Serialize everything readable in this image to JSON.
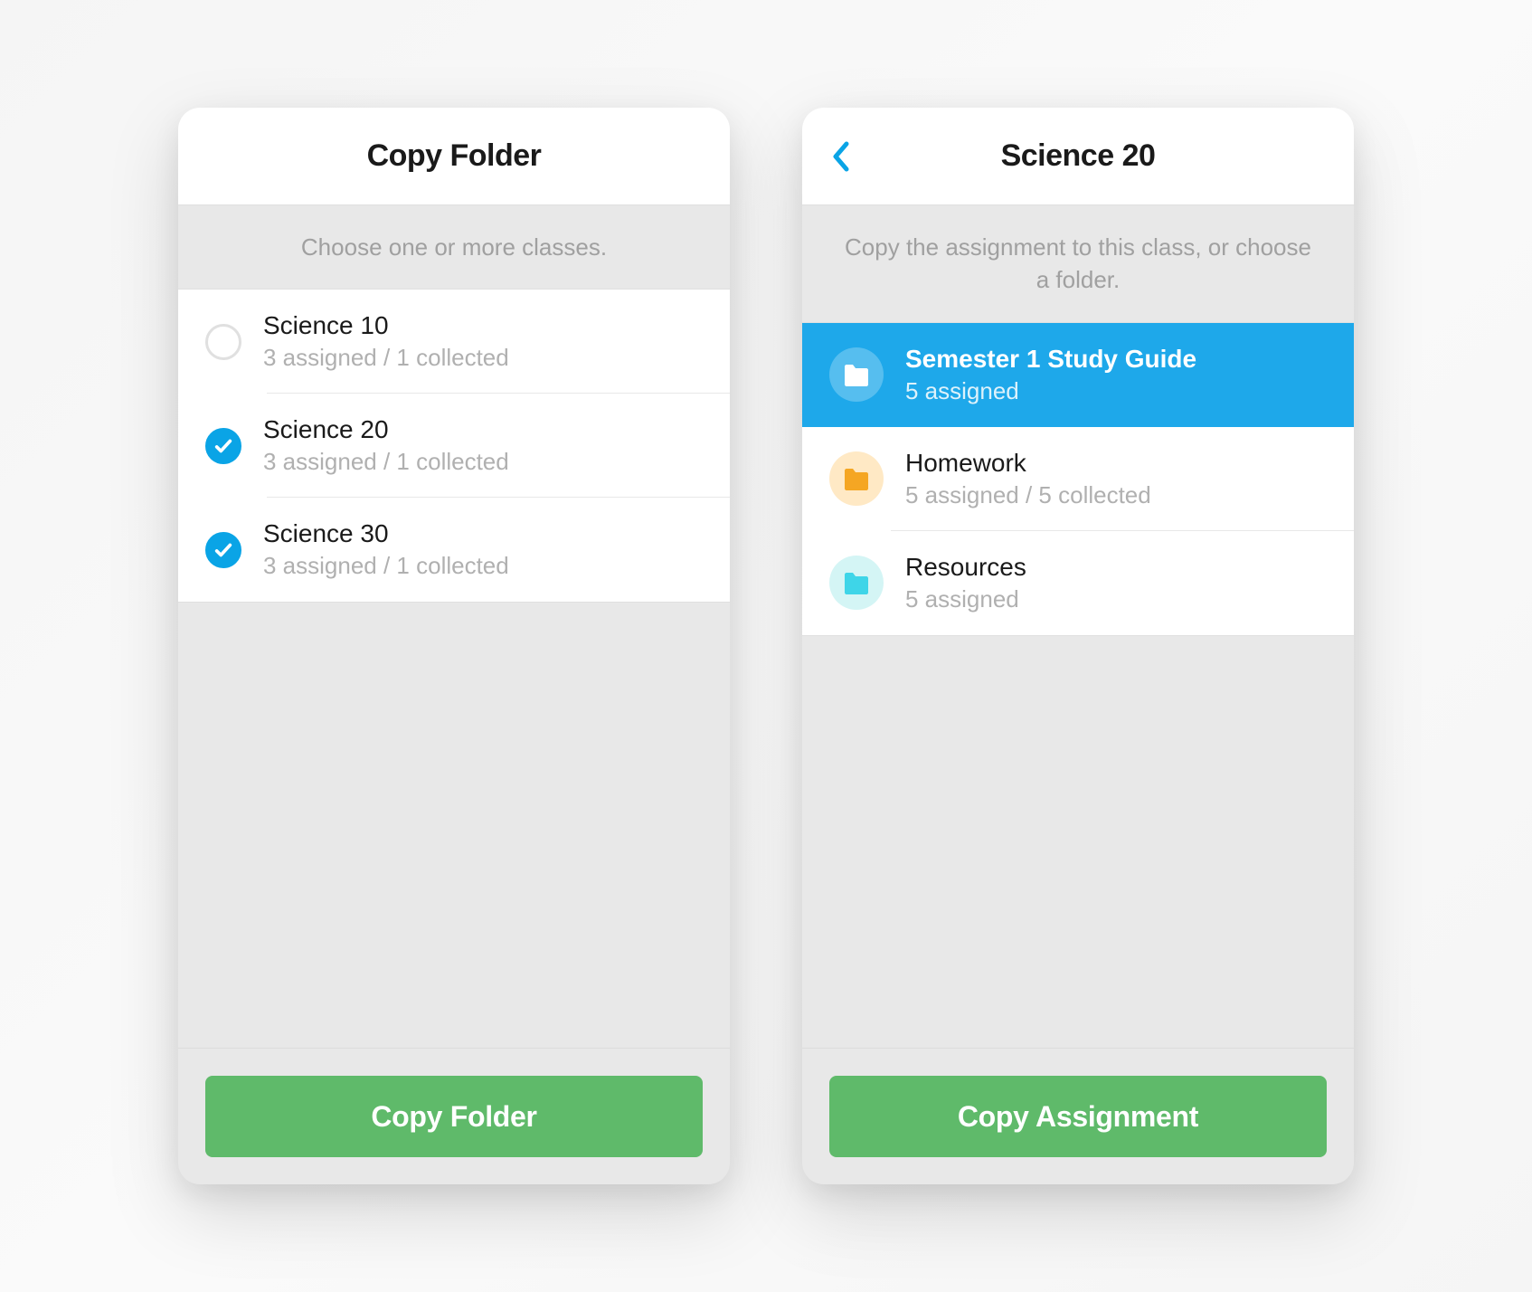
{
  "colors": {
    "accent_blue": "#0aa4e6",
    "selected_blue": "#1ea8ea",
    "button_green": "#5fba6a",
    "folder_orange": "#f5a623",
    "folder_orange_bg": "#ffe9c5",
    "folder_cyan": "#3ed5e8",
    "folder_cyan_bg": "#d4f5f5"
  },
  "left_screen": {
    "header_title": "Copy Folder",
    "instruction": "Choose one or more classes.",
    "classes": [
      {
        "name": "Science 10",
        "subtitle": "3 assigned / 1 collected",
        "checked": false
      },
      {
        "name": "Science 20",
        "subtitle": "3 assigned / 1 collected",
        "checked": true
      },
      {
        "name": "Science 30",
        "subtitle": "3 assigned / 1 collected",
        "checked": true
      }
    ],
    "button_label": "Copy Folder"
  },
  "right_screen": {
    "header_title": "Science 20",
    "instruction": "Copy the assignment to this class, or choose a folder.",
    "folders": [
      {
        "name": "Semester 1 Study Guide",
        "subtitle": "5 assigned",
        "selected": true,
        "icon_color": "white"
      },
      {
        "name": "Homework",
        "subtitle": "5 assigned / 5 collected",
        "selected": false,
        "icon_color": "orange"
      },
      {
        "name": "Resources",
        "subtitle": "5 assigned",
        "selected": false,
        "icon_color": "cyan"
      }
    ],
    "button_label": "Copy Assignment"
  }
}
